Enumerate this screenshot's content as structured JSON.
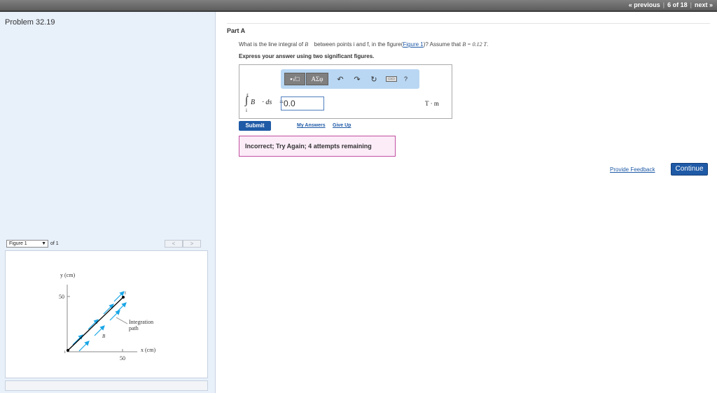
{
  "nav": {
    "previous": "« previous",
    "position": "6 of 18",
    "next": "next »"
  },
  "problem": {
    "title": "Problem 32.19"
  },
  "figure": {
    "select_value": "Figure 1",
    "of_label": "of 1",
    "y_axis_label": "y (cm)",
    "x_axis_label": "x (cm)",
    "y_tick": "50",
    "x_tick": "50",
    "path_label": "Integration path",
    "field_label": "B",
    "point_i": "i",
    "point_f": "f",
    "colors": {
      "field_arrow": "#1aa6e6",
      "path": "#000000"
    }
  },
  "part": {
    "title": "Part A",
    "question_pre": "What is the line integral of",
    "question_vec": "B⃗",
    "question_mid": "between points i and f, in the figure(",
    "figure_link": "Figure 1",
    "question_post": ")? Assume that",
    "assume": "B = 0.12 T",
    "instruction": "Express your answer using two significant figures."
  },
  "answer": {
    "lim_top": "f",
    "lim_bottom": "i",
    "expression": "B⃗ · ds⃗ =",
    "value": "0.0",
    "unit": "T · m"
  },
  "toolbar": {
    "template_icon": "▪√□",
    "greek_icon": "ΑΣφ",
    "undo": "↶",
    "redo": "↷",
    "reset": "↻",
    "help": "?"
  },
  "actions": {
    "submit": "Submit",
    "my_answers": "My Answers",
    "give_up": "Give Up",
    "feedback": "Incorrect; Try Again; 4 attempts remaining",
    "provide_feedback": "Provide Feedback",
    "continue": "Continue"
  }
}
